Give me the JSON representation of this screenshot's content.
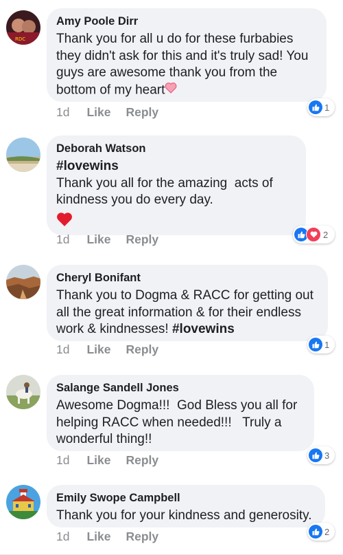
{
  "comments": [
    {
      "author": "Amy Poole Dirr",
      "text": "Thank you for all u do for these furbabies they didn't ask for this and it's truly sad! You guys are awesome thank you from the bottom of my heart",
      "time": "1d",
      "like": "Like",
      "reply": "Reply",
      "reactions": "1",
      "avatar_icon": "profile-photo-icon"
    },
    {
      "author": "Deborah Watson",
      "hashtag": "#lovewins",
      "text": "Thank you all for the amazing  acts of kindness you do every day.",
      "time": "1d",
      "like": "Like",
      "reply": "Reply",
      "reactions": "2",
      "avatar_icon": "profile-photo-icon"
    },
    {
      "author": "Cheryl Bonifant",
      "text": "Thank you to Dogma & RACC for getting out all the great information & for their endless work & kindnesses! ",
      "hashtag": "#lovewins",
      "time": "1d",
      "like": "Like",
      "reply": "Reply",
      "reactions": "1",
      "avatar_icon": "profile-photo-icon"
    },
    {
      "author": "Salange Sandell Jones",
      "text": "Awesome Dogma!!!  God Bless you all for helping RACC when needed!!!   Truly a wonderful thing!!",
      "time": "1d",
      "like": "Like",
      "reply": "Reply",
      "reactions": "3",
      "avatar_icon": "profile-photo-icon"
    },
    {
      "author": "Emily Swope Campbell",
      "text": "Thank you for your kindness and generosity.",
      "time": "1d",
      "like": "Like",
      "reply": "Reply",
      "reactions": "2",
      "avatar_icon": "profile-photo-icon"
    }
  ],
  "colors": {
    "bubble": "#f0f2f5",
    "like_blue": "#1877f2",
    "love_red": "#f33e58",
    "meta_gray": "#8a8d91"
  }
}
